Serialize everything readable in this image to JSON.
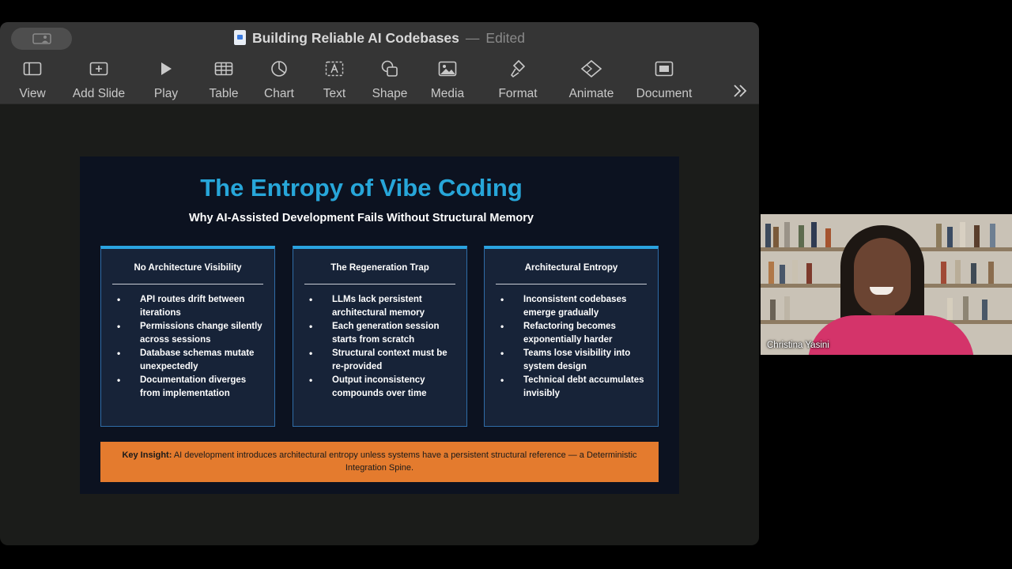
{
  "window": {
    "title": "Building Reliable AI Codebases",
    "separator": "—",
    "status": "Edited"
  },
  "toolbar": {
    "items": [
      {
        "label": "View",
        "icon": "sidebar-view-icon"
      },
      {
        "label": "Add Slide",
        "icon": "add-slide-icon"
      },
      {
        "label": "Play",
        "icon": "play-icon"
      },
      {
        "label": "Table",
        "icon": "table-icon"
      },
      {
        "label": "Chart",
        "icon": "chart-icon"
      },
      {
        "label": "Text",
        "icon": "text-box-icon"
      },
      {
        "label": "Shape",
        "icon": "shape-icon"
      },
      {
        "label": "Media",
        "icon": "media-icon"
      },
      {
        "label": "Format",
        "icon": "format-brush-icon"
      },
      {
        "label": "Animate",
        "icon": "animate-icon"
      },
      {
        "label": "Document",
        "icon": "document-icon"
      }
    ],
    "more_icon": "chevron-double-right-icon"
  },
  "slide": {
    "title": "The Entropy of Vibe Coding",
    "subtitle": "Why AI-Assisted Development Fails Without Structural Memory",
    "accent_color": "#27a6d9",
    "cards": [
      {
        "heading": "No Architecture Visibility",
        "bullets": [
          "API routes drift between iterations",
          "Permissions change silently across sessions",
          "Database schemas mutate unexpectedly",
          "Documentation diverges from implementation"
        ]
      },
      {
        "heading": "The Regeneration Trap",
        "bullets": [
          "LLMs lack persistent architectural memory",
          "Each generation session starts from scratch",
          "Structural context must be re-provided",
          "Output inconsistency compounds over time"
        ]
      },
      {
        "heading": "Architectural Entropy",
        "bullets": [
          "Inconsistent codebases emerge gradually",
          "Refactoring becomes exponentially harder",
          "Teams lose visibility into system design",
          "Technical debt accumulates invisibly"
        ]
      }
    ],
    "insight": {
      "label": "Key Insight:",
      "text": "AI development introduces architectural entropy unless systems have a persistent structural reference — a Deterministic Integration Spine.",
      "color": "#e47b2e"
    }
  },
  "video": {
    "participant_name": "Christina Yasini"
  }
}
